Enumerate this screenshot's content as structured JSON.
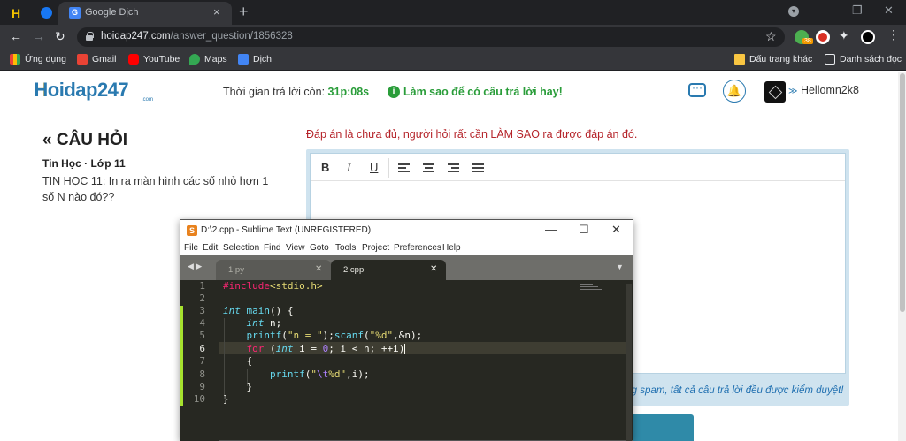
{
  "browser": {
    "tab_active_title": "Google Dịch",
    "tab_close": "×",
    "new_tab": "+",
    "url_host": "hoidap247.com",
    "url_path": "/answer_question/1856328",
    "extension_badge": "38",
    "bookmarks": [
      {
        "label": "Ứng dụng",
        "icon": "apps-grid-icon",
        "color": "#ea4335"
      },
      {
        "label": "Gmail",
        "icon": "gmail-icon",
        "color": "#ea4335"
      },
      {
        "label": "YouTube",
        "icon": "youtube-icon",
        "color": "#ff0000"
      },
      {
        "label": "Maps",
        "icon": "maps-pin-icon",
        "color": "#34a853"
      },
      {
        "label": "Dịch",
        "icon": "google-translate-icon",
        "color": "#4285f4"
      }
    ],
    "bookmark_folder": "Dấu trang khác",
    "reading_list": "Danh sách đọc"
  },
  "site": {
    "logo_main": "Hoidap247",
    "logo_sub": ".com",
    "timer_label": "Thời gian trả lời còn:",
    "timer_value": "31p:08s",
    "tip": "Làm sao để có câu trả lời hay!",
    "user_name": "Hellomn2k8",
    "accent": "#2a7ab0"
  },
  "question": {
    "heading": "« CÂU HỎI",
    "meta": "Tin Học · Lớp 11",
    "text": "TIN HỌC 11: In ra màn hình các số nhỏ hơn 1 số N nào đó??"
  },
  "answer": {
    "warning": "Đáp án là chưa đủ, người hỏi rất cần LÀM SAO ra được đáp án đó.",
    "toolbar": [
      "B",
      "I",
      "U"
    ],
    "note": "ừng spam, tất cả câu trả lời đều được kiểm duyệt!"
  },
  "sublime": {
    "title": "D:\\2.cpp - Sublime Text (UNREGISTERED)",
    "logo": "S",
    "menu": [
      "File",
      "Edit",
      "Selection",
      "Find",
      "View",
      "Goto",
      "Tools",
      "Project",
      "Preferences",
      "Help"
    ],
    "tabs": [
      {
        "label": "1.py",
        "active": false
      },
      {
        "label": "2.cpp",
        "active": true
      }
    ],
    "line_numbers": [
      "1",
      "2",
      "3",
      "4",
      "5",
      "6",
      "7",
      "8",
      "9",
      "10"
    ],
    "current_line": "6"
  }
}
